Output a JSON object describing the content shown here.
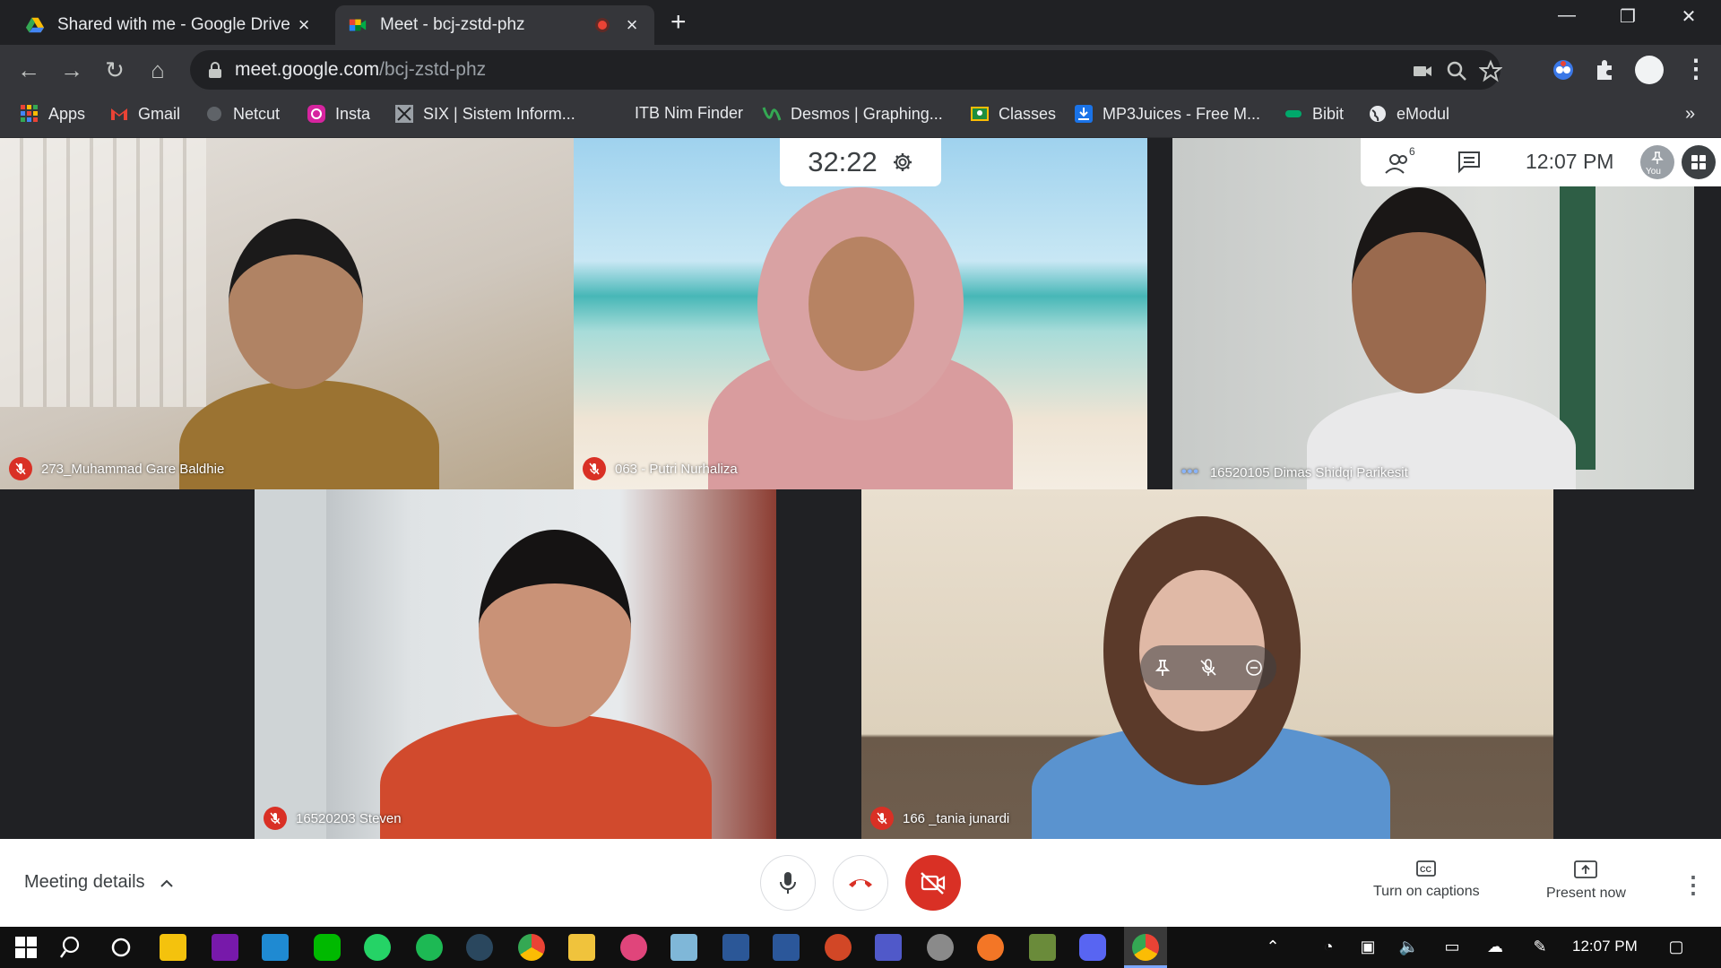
{
  "tabs": [
    {
      "title": "Shared with me - Google Drive",
      "active": false
    },
    {
      "title": "Meet - bcj-zstd-phz",
      "active": true
    }
  ],
  "url": {
    "host": "meet.google.com",
    "path": "/bcj-zstd-phz"
  },
  "bookmarks": [
    {
      "label": "Apps",
      "icon": "apps-grid-icon"
    },
    {
      "label": "Gmail",
      "icon": "gmail-icon"
    },
    {
      "label": "Netcut",
      "icon": "netcut-icon"
    },
    {
      "label": "Insta",
      "icon": "instagram-icon"
    },
    {
      "label": "SIX | Sistem Inform...",
      "icon": "six-icon"
    },
    {
      "label": "ITB Nim Finder",
      "icon": "none"
    },
    {
      "label": "Desmos | Graphing...",
      "icon": "desmos-icon"
    },
    {
      "label": "Classes",
      "icon": "classroom-icon"
    },
    {
      "label": "MP3Juices - Free M...",
      "icon": "download-icon"
    },
    {
      "label": "Bibit",
      "icon": "bibit-icon"
    },
    {
      "label": "eModul",
      "icon": "globe-icon"
    }
  ],
  "meeting": {
    "timer": "32:22",
    "clock": "12:07 PM",
    "participant_count": "6",
    "you_label": "You"
  },
  "participants": [
    {
      "name": "273_Muhammad Gare Baldhie",
      "muted": true
    },
    {
      "name": "063 - Putri Nurhaliza",
      "muted": true
    },
    {
      "name": "16520105 Dimas Shidqi Parikesit",
      "muted": false,
      "speaking": true
    },
    {
      "name": "16520203 Steven",
      "muted": true
    },
    {
      "name": "166 _tania junardi",
      "muted": true
    }
  ],
  "bottombar": {
    "meeting_details": "Meeting details",
    "captions": "Turn on captions",
    "present": "Present now"
  },
  "taskbar": {
    "time": "12:07 PM"
  },
  "colors": {
    "meet_red": "#d93025",
    "chrome_dark": "#202124",
    "chrome_toolbar": "#35363a"
  }
}
